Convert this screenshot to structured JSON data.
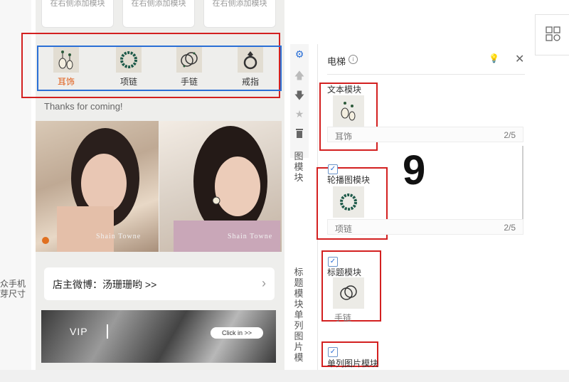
{
  "left_panel": {
    "label_line1": "众手机",
    "label_line2": "芽尺寸"
  },
  "top_stubs": [
    {
      "text": "在右侧添加模块"
    },
    {
      "text": "在右侧添加模块"
    },
    {
      "text": "在右侧添加模块"
    }
  ],
  "category_nav": {
    "items": [
      {
        "label": "耳饰",
        "icon": "earring-icon",
        "active": true
      },
      {
        "label": "项链",
        "icon": "necklace-icon",
        "active": false
      },
      {
        "label": "手链",
        "icon": "bracelet-icon",
        "active": false
      },
      {
        "label": "戒指",
        "icon": "ring-icon",
        "active": false
      }
    ],
    "active_color": "#e05a14"
  },
  "thanks_text": "Thanks for coming!",
  "photos": [
    {
      "watermark": "Shain Towne"
    },
    {
      "watermark": "Shain Towne"
    }
  ],
  "weibo": {
    "text": "店主微博：汤珊珊哟 >>",
    "chevron": "chevron-right-icon"
  },
  "vip_banner": {
    "vip": "VIP",
    "button": "Click in >>"
  },
  "toolbar": {
    "icons": [
      "gear-icon",
      "arrow-up-icon",
      "arrow-down-icon",
      "star-icon",
      "trash-icon"
    ],
    "vertical_label_1": "图模块",
    "vertical_label_2": "标题模块单列图片模"
  },
  "panel": {
    "title": "电梯",
    "modules": [
      {
        "label": "文本模块",
        "thumb": "earring-icon",
        "item_name": "耳饰",
        "count": "2/5"
      },
      {
        "label": "轮播图模块",
        "thumb": "necklace-icon",
        "item_name": "项链",
        "count": "2/5"
      },
      {
        "label": "标题模块",
        "thumb": "bracelet-icon",
        "item_name": "手链"
      },
      {
        "label": "单列图片模块"
      }
    ]
  },
  "annotation_number": "9",
  "colors": {
    "highlight_red": "#d32020",
    "highlight_blue": "#2a6fd6",
    "checkbox_blue": "#2a6fd6"
  }
}
